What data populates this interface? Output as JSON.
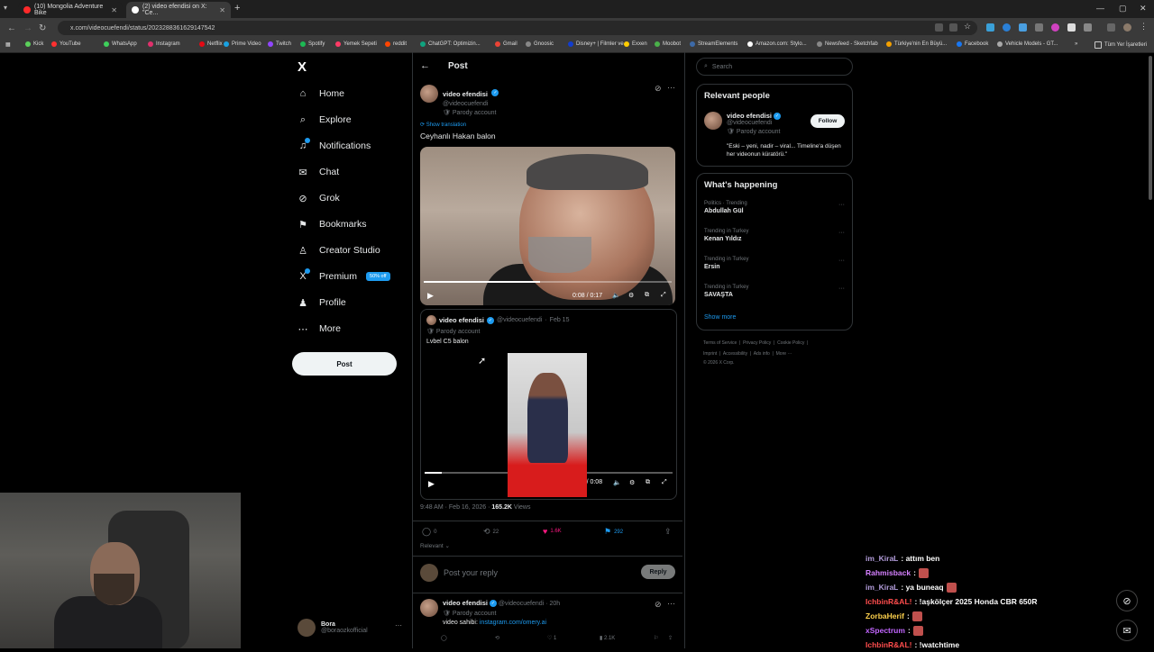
{
  "browser": {
    "tabs": [
      {
        "title": "(10) Mongolia Adventure Bike",
        "active": false
      },
      {
        "title": "(2) video efendisi on X: \"Ce...",
        "active": true
      }
    ],
    "url": "x.com/videocuefendi/status/2023288361629147542",
    "bookmarks": [
      "Kick",
      "YouTube",
      "WhatsApp",
      "Instagram",
      "Netflix",
      "Prime Video",
      "Twitch",
      "Spotify",
      "Yemek Sepeti",
      "reddit",
      "ChatGPT: Optimizin...",
      "Gmail",
      "Gnoosic",
      "Disney+ | Filmler ve...",
      "Exxen",
      "Moobot",
      "StreamElements",
      "Amazon.com: Stylo...",
      "Newsfeed - Sketchfab",
      "Türkiye'nin En Büyü...",
      "Facebook",
      "Vehicle Models - GT..."
    ],
    "bookmarks_overflow": "»",
    "all_bookmarks": "Tüm Yer İşaretleri"
  },
  "nav": {
    "logo": "X",
    "items": [
      {
        "label": "Home",
        "icon": "home-icon",
        "glyph": "⌂"
      },
      {
        "label": "Explore",
        "icon": "search-icon",
        "glyph": "⌕"
      },
      {
        "label": "Notifications",
        "icon": "bell-icon",
        "glyph": "♫"
      },
      {
        "label": "Chat",
        "icon": "mail-icon",
        "glyph": "✉"
      },
      {
        "label": "Grok",
        "icon": "grok-icon",
        "glyph": "⊘"
      },
      {
        "label": "Bookmarks",
        "icon": "bookmark-icon",
        "glyph": "⚑"
      },
      {
        "label": "Creator Studio",
        "icon": "creator-icon",
        "glyph": "♙"
      },
      {
        "label": "Premium",
        "icon": "x-premium-icon",
        "glyph": "X"
      },
      {
        "label": "Profile",
        "icon": "profile-icon",
        "glyph": "♟"
      },
      {
        "label": "More",
        "icon": "more-icon",
        "glyph": "⋯"
      }
    ],
    "premium_badge": "50% off",
    "post_button": "Post",
    "account": {
      "name": "Bora",
      "handle": "@boraozkofficial"
    }
  },
  "post": {
    "header": "Post",
    "author": {
      "name": "video efendisi",
      "handle": "@videocuefendi",
      "label": "Parody account"
    },
    "show_translation": "Show translation",
    "text": "Ceyhanlı Hakan balon",
    "video": {
      "time": "0:08 / 0:17",
      "progress": 0.47
    },
    "quote": {
      "name": "video efendisi",
      "handle": "@videocuefendi",
      "date": "Feb 15",
      "label": "Parody account",
      "text": "Lvbel C5 balon",
      "video_time": "0:01 / 0:08",
      "video_progress": 0.07
    },
    "timestamp": "9:48 AM · Feb 16, 2026 ·",
    "views_count": "165.2K",
    "views_label": "Views",
    "actions": {
      "replies": "0",
      "reposts": "22",
      "likes": "1.6K",
      "bookmarks": "292"
    },
    "sort": "Relevant",
    "reply_placeholder": "Post your reply",
    "reply_button": "Reply"
  },
  "reply_tweet": {
    "name": "video efendisi",
    "handle": "@videocuefendi",
    "age": "20h",
    "label": "Parody account",
    "text_prefix": "video sahibi:",
    "link": "instagram.com/omery.ai",
    "likes": "1",
    "views": "2.1K"
  },
  "sidebar": {
    "search_placeholder": "Search",
    "relevant_title": "Relevant people",
    "relevant_person": {
      "name": "video efendisi",
      "handle": "@videocuefendi",
      "label": "Parody account",
      "bio": "\"Eski – yeni, nadir – viral... Timeline'a düşen her videonun küratörü.\"",
      "follow": "Follow"
    },
    "happening_title": "What's happening",
    "trends": [
      {
        "context": "Politics · Trending",
        "name": "Abdullah Gül"
      },
      {
        "context": "Trending in Turkey",
        "name": "Kenan Yıldız"
      },
      {
        "context": "Trending in Turkey",
        "name": "Ersin"
      },
      {
        "context": "Trending in Turkey",
        "name": "SAVAŞTA"
      }
    ],
    "show_more": "Show more",
    "footer1": [
      "Terms of Service",
      "Privacy Policy",
      "Cookie Policy"
    ],
    "footer2": [
      "Imprint",
      "Accessibility",
      "Ads info",
      "More ···"
    ],
    "copyright": "© 2026 X Corp."
  },
  "chat": [
    {
      "user": "im_KiraL",
      "color": "#b39ddb",
      "msg": ": attım ben",
      "emote": false
    },
    {
      "user": "Rahmisback",
      "color": "#d580ff",
      "msg": ":",
      "emote": true
    },
    {
      "user": "im_KiraL",
      "color": "#b39ddb",
      "msg": ": ya buneaq",
      "emote": true
    },
    {
      "user": "IchbinR&AL!",
      "color": "#ff4d4d",
      "msg": ": !aşkölçer 2025 Honda CBR 650R",
      "emote": false
    },
    {
      "user": "ZorbaHerif",
      "color": "#ffd24d",
      "msg": ":",
      "emote": true
    },
    {
      "user": "xSpectrum",
      "color": "#c266ff",
      "msg": ":",
      "emote": true
    },
    {
      "user": "IchbinR&AL!",
      "color": "#ff4d4d",
      "msg": ": !watchtime",
      "emote": false
    }
  ],
  "colors": {
    "accent": "#1d9bf0",
    "like": "#f91880",
    "bg": "#000000"
  }
}
